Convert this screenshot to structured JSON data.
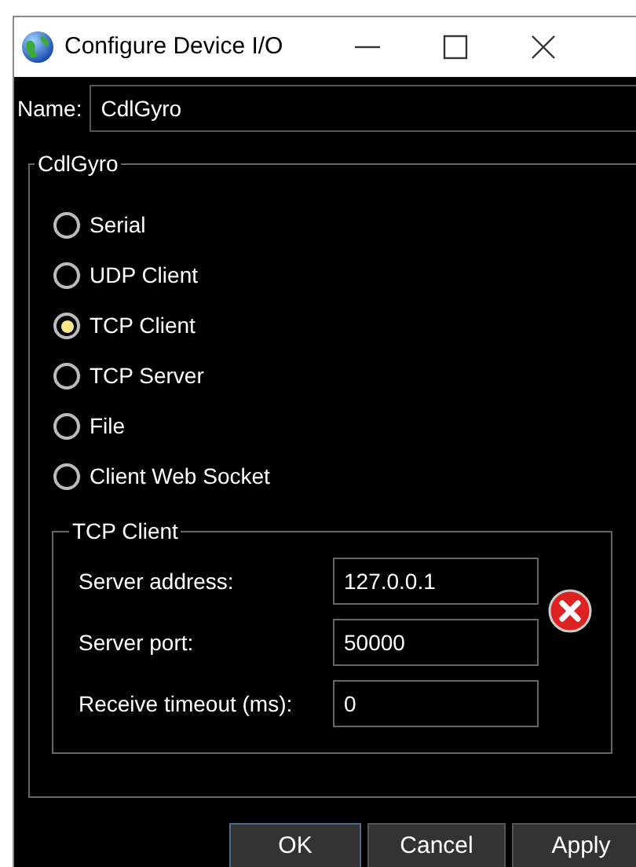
{
  "window": {
    "title": "Configure Device I/O"
  },
  "name_field": {
    "label": "Name:",
    "value": "CdlGyro"
  },
  "group": {
    "title": "CdlGyro",
    "options": [
      {
        "label": "Serial",
        "selected": false
      },
      {
        "label": "UDP Client",
        "selected": false
      },
      {
        "label": "TCP Client",
        "selected": true
      },
      {
        "label": "TCP Server",
        "selected": false
      },
      {
        "label": "File",
        "selected": false
      },
      {
        "label": "Client Web Socket",
        "selected": false
      }
    ]
  },
  "settings": {
    "title": "TCP Client",
    "error": true,
    "fields": [
      {
        "label": "Server address:",
        "value": "127.0.0.1"
      },
      {
        "label": "Server port:",
        "value": "50000"
      },
      {
        "label": "Receive timeout (ms):",
        "value": "0"
      }
    ]
  },
  "buttons": [
    {
      "label": "OK",
      "default": true
    },
    {
      "label": "Cancel",
      "default": false
    },
    {
      "label": "Apply",
      "default": false
    }
  ]
}
